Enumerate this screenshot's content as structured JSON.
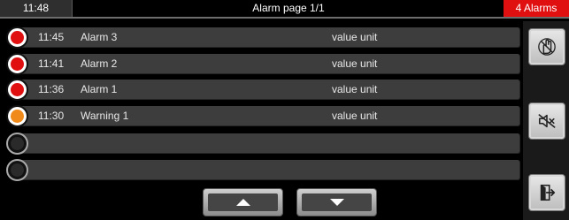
{
  "header": {
    "time": "11:48",
    "title": "Alarm page 1/1",
    "alarm_count": "4 Alarms"
  },
  "alarms": [
    {
      "time": "11:45",
      "name": "Alarm 3",
      "value": "value",
      "unit": "unit",
      "status": "alarm"
    },
    {
      "time": "11:41",
      "name": "Alarm 2",
      "value": "value",
      "unit": "unit",
      "status": "alarm"
    },
    {
      "time": "11:36",
      "name": "Alarm 1",
      "value": "value",
      "unit": "unit",
      "status": "alarm"
    },
    {
      "time": "11:30",
      "name": "Warning 1",
      "value": "value",
      "unit": "unit",
      "status": "warning"
    },
    {
      "time": "",
      "name": "",
      "value": "",
      "unit": "",
      "status": "empty"
    },
    {
      "time": "",
      "name": "",
      "value": "",
      "unit": "",
      "status": "empty"
    }
  ],
  "colors": {
    "alarm": "#e01010",
    "warning": "#f08a1a",
    "empty": "#2a2a2a",
    "header_alarm_bg": "#e01010"
  },
  "buttons": {
    "acknowledge_icon": "hand-acknowledge-icon",
    "mute_icon": "speaker-mute-icon",
    "exit_icon": "exit-door-icon",
    "up_icon": "arrow-up-icon",
    "down_icon": "arrow-down-icon"
  }
}
